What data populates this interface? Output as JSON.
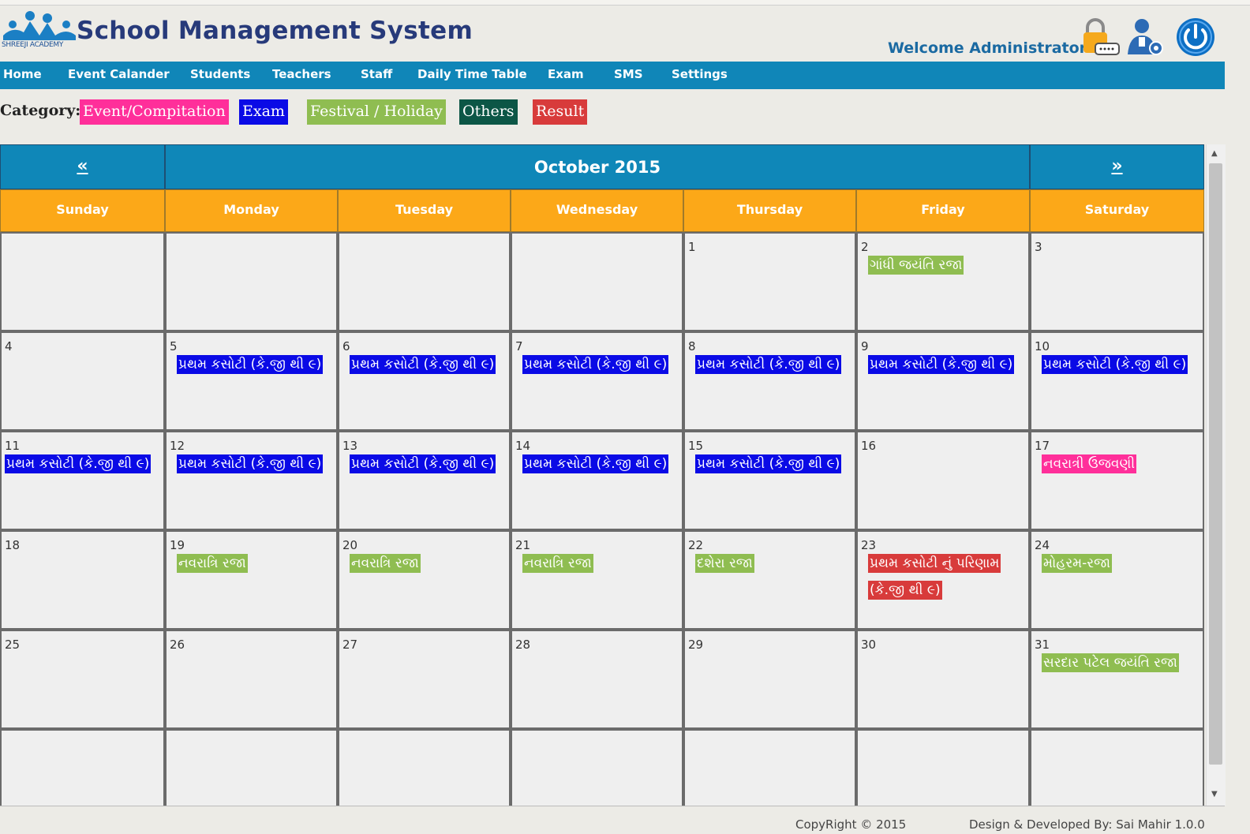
{
  "header": {
    "logo_text": "SHREEJI ACADEMY",
    "title": "School Management System",
    "welcome": "Welcome Administrator"
  },
  "nav": [
    "Home",
    "Event Calander",
    "Students",
    "Teachers",
    "Staff",
    "Daily Time Table",
    "Exam",
    "SMS",
    "Settings"
  ],
  "category": {
    "label": "Category:",
    "items": [
      {
        "label": "Event/Compitation",
        "color": "#ff2f9a"
      },
      {
        "label": "Exam",
        "color": "#0a0ae6"
      },
      {
        "label": "Festival / Holiday",
        "color": "#8fbd51"
      },
      {
        "label": "Others",
        "color": "#0c5646"
      },
      {
        "label": "Result",
        "color": "#d83b3b"
      }
    ]
  },
  "calendar": {
    "prev": "«",
    "month_title": "October 2015",
    "next": "»",
    "days": [
      "Sunday",
      "Monday",
      "Tuesday",
      "Wednesday",
      "Thursday",
      "Friday",
      "Saturday"
    ],
    "weeks": [
      [
        {
          "n": "",
          "events": []
        },
        {
          "n": "",
          "events": []
        },
        {
          "n": "",
          "events": []
        },
        {
          "n": "",
          "events": []
        },
        {
          "n": "1",
          "events": []
        },
        {
          "n": "2",
          "events": [
            {
              "t": "ગાંધી જયંતિ રજા",
              "c": "#8fbd51"
            }
          ]
        },
        {
          "n": "3",
          "events": []
        }
      ],
      [
        {
          "n": "4",
          "events": []
        },
        {
          "n": "5",
          "events": [
            {
              "t": "પ્રથમ કસોટી (કે.જી થી ૯)",
              "c": "#0a0ae6"
            }
          ]
        },
        {
          "n": "6",
          "events": [
            {
              "t": "પ્રથમ કસોટી (કે.જી થી ૯)",
              "c": "#0a0ae6"
            }
          ]
        },
        {
          "n": "7",
          "events": [
            {
              "t": "પ્રથમ કસોટી (કે.જી થી ૯)",
              "c": "#0a0ae6"
            }
          ]
        },
        {
          "n": "8",
          "events": [
            {
              "t": "પ્રથમ કસોટી (કે.જી થી ૯)",
              "c": "#0a0ae6"
            }
          ]
        },
        {
          "n": "9",
          "events": [
            {
              "t": "પ્રથમ કસોટી (કે.જી થી ૯)",
              "c": "#0a0ae6"
            }
          ]
        },
        {
          "n": "10",
          "events": [
            {
              "t": "પ્રથમ કસોટી (કે.જી થી ૯)",
              "c": "#0a0ae6"
            }
          ]
        }
      ],
      [
        {
          "n": "11",
          "events": [
            {
              "t": "પ્રથમ કસોટી (કે.જી થી ૯)",
              "c": "#0a0ae6"
            }
          ]
        },
        {
          "n": "12",
          "events": [
            {
              "t": "પ્રથમ કસોટી (કે.જી થી ૯)",
              "c": "#0a0ae6"
            }
          ]
        },
        {
          "n": "13",
          "events": [
            {
              "t": "પ્રથમ કસોટી (કે.જી થી ૯)",
              "c": "#0a0ae6"
            }
          ]
        },
        {
          "n": "14",
          "events": [
            {
              "t": "પ્રથમ કસોટી (કે.જી થી ૯)",
              "c": "#0a0ae6"
            }
          ]
        },
        {
          "n": "15",
          "events": [
            {
              "t": "પ્રથમ કસોટી (કે.જી થી ૯)",
              "c": "#0a0ae6"
            }
          ]
        },
        {
          "n": "16",
          "events": []
        },
        {
          "n": "17",
          "events": [
            {
              "t": "નવરાત્રી ઉજવણી",
              "c": "#ff2f9a"
            }
          ]
        }
      ],
      [
        {
          "n": "18",
          "events": []
        },
        {
          "n": "19",
          "events": [
            {
              "t": "નવરાત્રિ રજા",
              "c": "#8fbd51"
            }
          ]
        },
        {
          "n": "20",
          "events": [
            {
              "t": "નવરાત્રિ રજા",
              "c": "#8fbd51"
            }
          ]
        },
        {
          "n": "21",
          "events": [
            {
              "t": "નવરાત્રિ રજા",
              "c": "#8fbd51"
            }
          ]
        },
        {
          "n": "22",
          "events": [
            {
              "t": "દશેરા રજા",
              "c": "#8fbd51"
            }
          ]
        },
        {
          "n": "23",
          "events": [
            {
              "t": "પ્રથમ કસોટી નું પરિણામ (કે.જી થી ૯)",
              "c": "#d83b3b"
            }
          ]
        },
        {
          "n": "24",
          "events": [
            {
              "t": "મોહરમ-રજા",
              "c": "#8fbd51"
            }
          ]
        }
      ],
      [
        {
          "n": "25",
          "events": []
        },
        {
          "n": "26",
          "events": []
        },
        {
          "n": "27",
          "events": []
        },
        {
          "n": "28",
          "events": []
        },
        {
          "n": "29",
          "events": []
        },
        {
          "n": "30",
          "events": []
        },
        {
          "n": "31",
          "events": [
            {
              "t": "સરદાર પટેલ જયંતિ રજા",
              "c": "#8fbd51"
            }
          ]
        }
      ],
      [
        {
          "n": "",
          "events": []
        },
        {
          "n": "",
          "events": []
        },
        {
          "n": "",
          "events": []
        },
        {
          "n": "",
          "events": []
        },
        {
          "n": "",
          "events": []
        },
        {
          "n": "",
          "events": []
        },
        {
          "n": "",
          "events": []
        }
      ]
    ]
  },
  "footer": {
    "copyright": "CopyRight © 2015",
    "credit": "Design & Developed By: Sai Mahir 1.0.0"
  }
}
